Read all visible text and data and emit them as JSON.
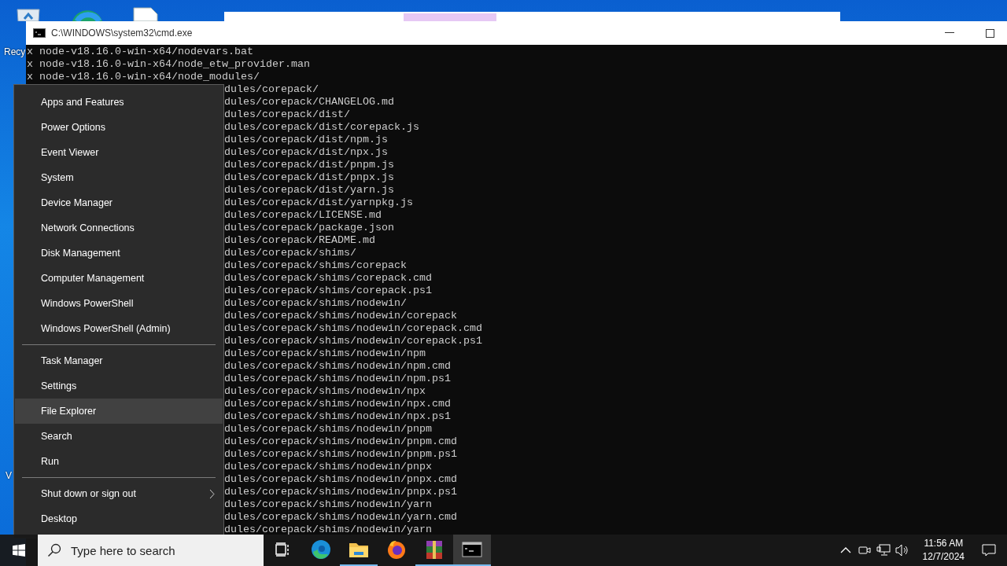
{
  "desktop_icons": [
    {
      "kind": "recycle-bin",
      "label": "Recy"
    },
    {
      "kind": "browser"
    },
    {
      "kind": "document"
    },
    {
      "kind": "partial",
      "label": "V"
    }
  ],
  "console": {
    "title": "C:\\WINDOWS\\system32\\cmd.exe",
    "lines": [
      {
        "kind": "full",
        "text": "x node-v18.16.0-win-x64/nodevars.bat"
      },
      {
        "kind": "full",
        "text": "x node-v18.16.0-win-x64/node_etw_provider.man"
      },
      {
        "kind": "full",
        "text": "x node-v18.16.0-win-x64/node_modules/"
      },
      {
        "kind": "cut",
        "text": "dules/corepack/"
      },
      {
        "kind": "cut",
        "text": "dules/corepack/CHANGELOG.md"
      },
      {
        "kind": "cut",
        "text": "dules/corepack/dist/"
      },
      {
        "kind": "cut",
        "text": "dules/corepack/dist/corepack.js"
      },
      {
        "kind": "cut",
        "text": "dules/corepack/dist/npm.js"
      },
      {
        "kind": "cut",
        "text": "dules/corepack/dist/npx.js"
      },
      {
        "kind": "cut",
        "text": "dules/corepack/dist/pnpm.js"
      },
      {
        "kind": "cut",
        "text": "dules/corepack/dist/pnpx.js"
      },
      {
        "kind": "cut",
        "text": "dules/corepack/dist/yarn.js"
      },
      {
        "kind": "cut",
        "text": "dules/corepack/dist/yarnpkg.js"
      },
      {
        "kind": "cut",
        "text": "dules/corepack/LICENSE.md"
      },
      {
        "kind": "cut",
        "text": "dules/corepack/package.json"
      },
      {
        "kind": "cut",
        "text": "dules/corepack/README.md"
      },
      {
        "kind": "cut",
        "text": "dules/corepack/shims/"
      },
      {
        "kind": "cut",
        "text": "dules/corepack/shims/corepack"
      },
      {
        "kind": "cut",
        "text": "dules/corepack/shims/corepack.cmd"
      },
      {
        "kind": "cut",
        "text": "dules/corepack/shims/corepack.ps1"
      },
      {
        "kind": "cut",
        "text": "dules/corepack/shims/nodewin/"
      },
      {
        "kind": "cut",
        "text": "dules/corepack/shims/nodewin/corepack"
      },
      {
        "kind": "cut",
        "text": "dules/corepack/shims/nodewin/corepack.cmd"
      },
      {
        "kind": "cut",
        "text": "dules/corepack/shims/nodewin/corepack.ps1"
      },
      {
        "kind": "cut",
        "text": "dules/corepack/shims/nodewin/npm"
      },
      {
        "kind": "cut",
        "text": "dules/corepack/shims/nodewin/npm.cmd"
      },
      {
        "kind": "cut",
        "text": "dules/corepack/shims/nodewin/npm.ps1"
      },
      {
        "kind": "cut",
        "text": "dules/corepack/shims/nodewin/npx"
      },
      {
        "kind": "cut",
        "text": "dules/corepack/shims/nodewin/npx.cmd"
      },
      {
        "kind": "cut",
        "text": "dules/corepack/shims/nodewin/npx.ps1"
      },
      {
        "kind": "cut",
        "text": "dules/corepack/shims/nodewin/pnpm"
      },
      {
        "kind": "cut",
        "text": "dules/corepack/shims/nodewin/pnpm.cmd"
      },
      {
        "kind": "cut",
        "text": "dules/corepack/shims/nodewin/pnpm.ps1"
      },
      {
        "kind": "cut",
        "text": "dules/corepack/shims/nodewin/pnpx"
      },
      {
        "kind": "cut",
        "text": "dules/corepack/shims/nodewin/pnpx.cmd"
      },
      {
        "kind": "cut",
        "text": "dules/corepack/shims/nodewin/pnpx.ps1"
      },
      {
        "kind": "cut",
        "text": "dules/corepack/shims/nodewin/yarn"
      },
      {
        "kind": "cut",
        "text": "dules/corepack/shims/nodewin/yarn.cmd"
      },
      {
        "kind": "cut",
        "text": "dules/corepack/shims/nodewin/yarn"
      }
    ]
  },
  "context_menu": {
    "sections": [
      [
        {
          "label": "Apps and Features",
          "highlighted": false
        },
        {
          "label": "Power Options",
          "highlighted": false
        },
        {
          "label": "Event Viewer",
          "highlighted": false
        },
        {
          "label": "System",
          "highlighted": false
        },
        {
          "label": "Device Manager",
          "highlighted": false
        },
        {
          "label": "Network Connections",
          "highlighted": false
        },
        {
          "label": "Disk Management",
          "highlighted": false
        },
        {
          "label": "Computer Management",
          "highlighted": false
        },
        {
          "label": "Windows PowerShell",
          "highlighted": false
        },
        {
          "label": "Windows PowerShell (Admin)",
          "highlighted": false
        }
      ],
      [
        {
          "label": "Task Manager",
          "highlighted": false
        },
        {
          "label": "Settings",
          "highlighted": false
        },
        {
          "label": "File Explorer",
          "highlighted": true
        },
        {
          "label": "Search",
          "highlighted": false
        },
        {
          "label": "Run",
          "highlighted": false
        }
      ],
      [
        {
          "label": "Shut down or sign out",
          "highlighted": false,
          "submenu": true
        },
        {
          "label": "Desktop",
          "highlighted": false
        }
      ]
    ]
  },
  "taskbar": {
    "search": {
      "placeholder": "Type here to search"
    },
    "apps": [
      {
        "kind": "task-view",
        "running": false,
        "active": false
      },
      {
        "kind": "edge",
        "running": false,
        "active": false
      },
      {
        "kind": "explorer",
        "running": true,
        "active": false
      },
      {
        "kind": "firefox",
        "running": false,
        "active": false
      },
      {
        "kind": "archiver",
        "running": true,
        "active": false
      },
      {
        "kind": "console",
        "running": true,
        "active": true
      }
    ],
    "tray": [
      {
        "kind": "chevron"
      },
      {
        "kind": "camera"
      },
      {
        "kind": "network"
      },
      {
        "kind": "volume"
      }
    ],
    "time": "11:56 AM",
    "date": "12/7/2024"
  }
}
